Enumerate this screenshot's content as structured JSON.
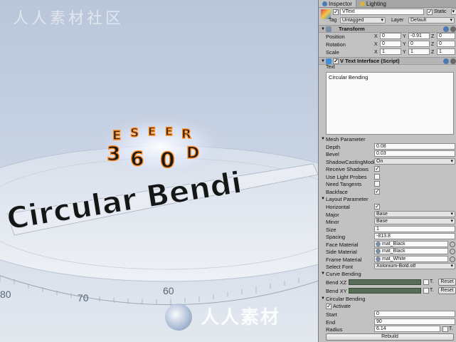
{
  "scene": {
    "watermark_top": "人人素材社区",
    "watermark_bottom": "人人素材",
    "ring_chars": [
      "3",
      "6",
      "0",
      "D",
      "R",
      "E",
      "E",
      "S",
      "E"
    ],
    "main_text": "Circular Bendi",
    "ruler_labels": [
      "80",
      "70",
      "60"
    ]
  },
  "tabs": {
    "inspector": "Inspector",
    "lighting": "Lighting"
  },
  "object": {
    "name": "VText",
    "static_label": "Static",
    "tag_label": "Tag",
    "tag_value": "Untagged",
    "layer_label": "Layer",
    "layer_value": "Default"
  },
  "transform": {
    "title": "Transform",
    "position_label": "Position",
    "rotation_label": "Rotation",
    "scale_label": "Scale",
    "position": {
      "x": "0",
      "y": "-0.91",
      "z": "0"
    },
    "rotation": {
      "x": "0",
      "y": "0",
      "z": "0"
    },
    "scale": {
      "x": "1",
      "y": "1",
      "z": "1"
    }
  },
  "script": {
    "title": "V Text Interface (Script)",
    "text_label": "Text",
    "text_value": "Circular Bending"
  },
  "mesh": {
    "title": "Mesh Parameter",
    "depth_label": "Depth",
    "depth": "0.08",
    "bevel_label": "Bevel",
    "bevel": "0.03",
    "shadow_label": "ShadowCastingMode",
    "shadow": "On",
    "receive_label": "Receive Shadows",
    "probes_label": "Use Light Probes",
    "tangents_label": "Need Tangents",
    "backface_label": "Backface"
  },
  "layout": {
    "title": "Layout Parameter",
    "horizontal_label": "Horizontal",
    "major_label": "Major",
    "major": "Base",
    "minor_label": "Minor",
    "minor": "Base",
    "size_label": "Size",
    "size": "1",
    "spacing_label": "Spacing",
    "spacing": "-813.8",
    "face_label": "Face Material",
    "face": "mat_Black",
    "side_label": "Side Material",
    "side": "mat_Black",
    "frame_label": "Frame Material",
    "frame": "mat_White",
    "font_label": "Select Font",
    "font": "Xolonium-Bold.otf"
  },
  "curve": {
    "title": "Curve Bending",
    "xz_label": "Bend XZ",
    "xy_label": "Bend XY",
    "t_label": "T.",
    "reset_label": "Reset"
  },
  "circular": {
    "title": "Circular Bending",
    "activate_label": "Activate",
    "start_label": "Start",
    "start": "0",
    "end_label": "End",
    "end": "90",
    "radius_label": "Radius",
    "radius": "6.14",
    "t_label": "T.",
    "rebuild_label": "Rebuild"
  },
  "colors": {
    "bend_bar": "#586d58",
    "ring_orange": "#ff8a1c",
    "text_dark": "#1a1a1a"
  }
}
